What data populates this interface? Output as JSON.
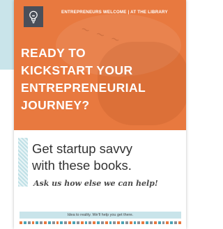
{
  "poster": {
    "header_tag": "ENTREPRENEURS WELCOME  |  AT THE LIBRARY",
    "headline_lines": [
      "READY TO",
      "KICKSTART YOUR",
      "ENTREPRENEURIAL",
      "JOURNEY?"
    ],
    "subheading_lines": [
      "Get startup savvy",
      "with these books."
    ],
    "script_line": "Ask us how else we can help!",
    "footer": "Idea to reality. We'll help you get there.",
    "icon": "lightbulb-icon"
  },
  "colors": {
    "hero_orange": "#e8793f",
    "teal_light": "#c9e4ea",
    "icon_box": "#4a4f59",
    "dash_orange": "#e8793f",
    "dash_teal": "#4aa3b5",
    "dash_gray": "#8a8f96"
  }
}
